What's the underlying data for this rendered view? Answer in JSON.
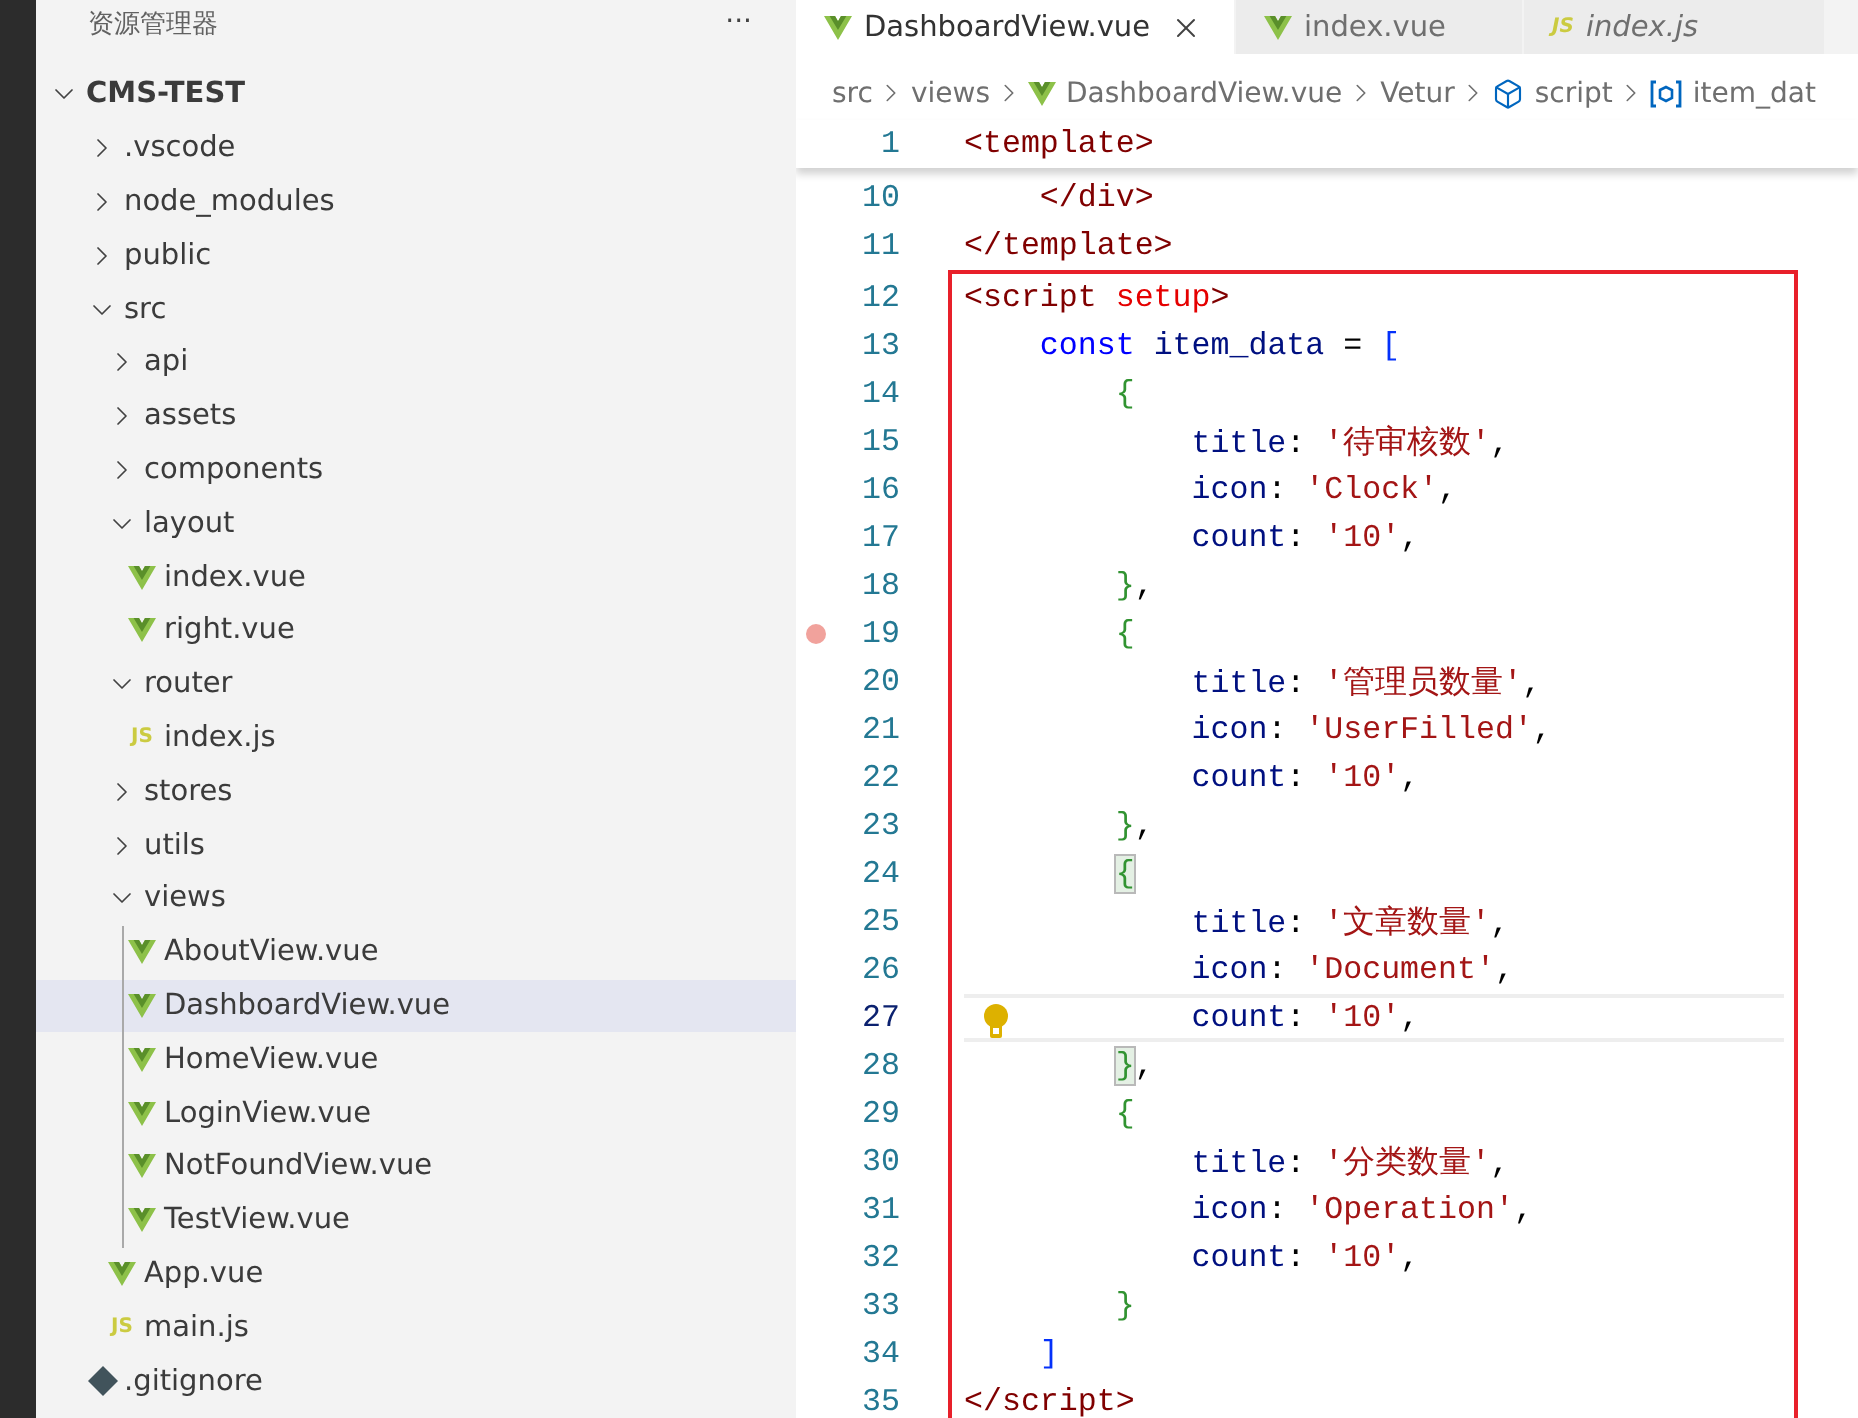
{
  "explorer": {
    "title": "资源管理器",
    "more": "···",
    "tree": [
      {
        "label": "CMS-TEST",
        "kind": "folder",
        "expanded": true,
        "selected": false,
        "children": [
          {
            "label": ".vscode",
            "kind": "folder",
            "expanded": false,
            "selected": false
          },
          {
            "label": "node_modules",
            "kind": "folder",
            "expanded": false,
            "selected": false
          },
          {
            "label": "public",
            "kind": "folder",
            "expanded": false,
            "selected": false
          },
          {
            "label": "src",
            "kind": "folder",
            "expanded": true,
            "selected": false,
            "children": [
              {
                "label": "api",
                "kind": "folder",
                "expanded": false,
                "selected": false
              },
              {
                "label": "assets",
                "kind": "folder",
                "expanded": false,
                "selected": false
              },
              {
                "label": "components",
                "kind": "folder",
                "expanded": false,
                "selected": false
              },
              {
                "label": "layout",
                "kind": "folder",
                "expanded": true,
                "selected": false,
                "children": [
                  {
                    "label": "index.vue",
                    "kind": "vue",
                    "selected": false
                  },
                  {
                    "label": "right.vue",
                    "kind": "vue",
                    "selected": false
                  }
                ]
              },
              {
                "label": "router",
                "kind": "folder",
                "expanded": true,
                "selected": false,
                "children": [
                  {
                    "label": "index.js",
                    "kind": "js",
                    "badge": "JS",
                    "selected": false
                  }
                ]
              },
              {
                "label": "stores",
                "kind": "folder",
                "expanded": false,
                "selected": false
              },
              {
                "label": "utils",
                "kind": "folder",
                "expanded": false,
                "selected": false
              },
              {
                "label": "views",
                "kind": "folder",
                "expanded": true,
                "selected": false,
                "children": [
                  {
                    "label": "AboutView.vue",
                    "kind": "vue",
                    "selected": false
                  },
                  {
                    "label": "DashboardView.vue",
                    "kind": "vue",
                    "selected": true
                  },
                  {
                    "label": "HomeView.vue",
                    "kind": "vue",
                    "selected": false
                  },
                  {
                    "label": "LoginView.vue",
                    "kind": "vue",
                    "selected": false
                  },
                  {
                    "label": "NotFoundView.vue",
                    "kind": "vue",
                    "selected": false
                  },
                  {
                    "label": "TestView.vue",
                    "kind": "vue",
                    "selected": false
                  }
                ]
              },
              {
                "label": "App.vue",
                "kind": "vue",
                "selected": false
              },
              {
                "label": "main.js",
                "kind": "js",
                "badge": "JS",
                "selected": false
              }
            ]
          },
          {
            "label": ".gitignore",
            "kind": "git",
            "selected": false
          }
        ]
      }
    ]
  },
  "tabs": [
    {
      "label": "DashboardView.vue",
      "kind": "vue",
      "selected": true,
      "preview": false
    },
    {
      "label": "index.vue",
      "kind": "vue",
      "selected": false,
      "preview": false
    },
    {
      "label": "index.js",
      "kind": "js",
      "badge": "JS",
      "selected": false,
      "preview": true
    }
  ],
  "breadcrumbs": [
    {
      "label": "src",
      "kind": "text"
    },
    {
      "label": "views",
      "kind": "text"
    },
    {
      "label": "DashboardView.vue",
      "kind": "vue"
    },
    {
      "label": "Vetur",
      "kind": "text"
    },
    {
      "label": "script",
      "kind": "module"
    },
    {
      "label": "item_dat",
      "kind": "variable"
    }
  ],
  "code": {
    "sticky_line": {
      "number": "1",
      "current": false,
      "tokens": [
        {
          "kind": "tag",
          "text": "<template>"
        }
      ]
    },
    "lines": [
      {
        "number": "10",
        "current": false,
        "tokens": [
          {
            "kind": "tag",
            "text": "    </div>"
          }
        ]
      },
      {
        "number": "11",
        "current": false,
        "tokens": [
          {
            "kind": "tag",
            "text": "</template>"
          }
        ]
      }
    ],
    "boxed_lines": [
      {
        "number": "12",
        "current": false,
        "tokens": [
          {
            "kind": "tag",
            "text": "<script "
          },
          {
            "kind": "attribute",
            "text": "setup"
          },
          {
            "kind": "tag",
            "text": ">"
          }
        ]
      },
      {
        "number": "13",
        "current": false,
        "tokens": [
          {
            "kind": "keyword",
            "text": "    const "
          },
          {
            "kind": "variable",
            "text": "item_data"
          },
          {
            "kind": "punct",
            "text": " = "
          },
          {
            "kind": "array",
            "text": "["
          }
        ]
      },
      {
        "number": "14",
        "current": false,
        "tokens": [
          {
            "kind": "brace",
            "text": "        {",
            "matched": false
          }
        ]
      },
      {
        "number": "15",
        "current": false,
        "tokens": [
          {
            "kind": "property",
            "text": "            title"
          },
          {
            "kind": "punct",
            "text": ": "
          },
          {
            "kind": "string",
            "text": "'待审核数'"
          },
          {
            "kind": "punct",
            "text": ","
          }
        ]
      },
      {
        "number": "16",
        "current": false,
        "tokens": [
          {
            "kind": "property",
            "text": "            icon"
          },
          {
            "kind": "punct",
            "text": ": "
          },
          {
            "kind": "string",
            "text": "'Clock'"
          },
          {
            "kind": "punct",
            "text": ","
          }
        ]
      },
      {
        "number": "17",
        "current": false,
        "tokens": [
          {
            "kind": "property",
            "text": "            count"
          },
          {
            "kind": "punct",
            "text": ": "
          },
          {
            "kind": "string",
            "text": "'10'"
          },
          {
            "kind": "punct",
            "text": ","
          }
        ]
      },
      {
        "number": "18",
        "current": false,
        "tokens": [
          {
            "kind": "brace",
            "text": "        }",
            "matched": false
          },
          {
            "kind": "punct",
            "text": ","
          }
        ]
      },
      {
        "number": "19",
        "current": false,
        "breakpoint_hint": true,
        "tokens": [
          {
            "kind": "brace",
            "text": "        {",
            "matched": false
          }
        ]
      },
      {
        "number": "20",
        "current": false,
        "tokens": [
          {
            "kind": "property",
            "text": "            title"
          },
          {
            "kind": "punct",
            "text": ": "
          },
          {
            "kind": "string",
            "text": "'管理员数量'"
          },
          {
            "kind": "punct",
            "text": ","
          }
        ]
      },
      {
        "number": "21",
        "current": false,
        "tokens": [
          {
            "kind": "property",
            "text": "            icon"
          },
          {
            "kind": "punct",
            "text": ": "
          },
          {
            "kind": "string",
            "text": "'UserFilled'"
          },
          {
            "kind": "punct",
            "text": ","
          }
        ]
      },
      {
        "number": "22",
        "current": false,
        "tokens": [
          {
            "kind": "property",
            "text": "            count"
          },
          {
            "kind": "punct",
            "text": ": "
          },
          {
            "kind": "string",
            "text": "'10'"
          },
          {
            "kind": "punct",
            "text": ","
          }
        ]
      },
      {
        "number": "23",
        "current": false,
        "tokens": [
          {
            "kind": "brace",
            "text": "        }",
            "matched": false
          },
          {
            "kind": "punct",
            "text": ","
          }
        ]
      },
      {
        "number": "24",
        "current": false,
        "tokens": [
          {
            "kind": "brace",
            "text": "        {",
            "matched": true
          }
        ]
      },
      {
        "number": "25",
        "current": false,
        "tokens": [
          {
            "kind": "property",
            "text": "            title"
          },
          {
            "kind": "punct",
            "text": ": "
          },
          {
            "kind": "string",
            "text": "'文章数量'"
          },
          {
            "kind": "punct",
            "text": ","
          }
        ]
      },
      {
        "number": "26",
        "current": false,
        "tokens": [
          {
            "kind": "property",
            "text": "            icon"
          },
          {
            "kind": "punct",
            "text": ": "
          },
          {
            "kind": "string",
            "text": "'Document'"
          },
          {
            "kind": "punct",
            "text": ","
          }
        ]
      },
      {
        "number": "27",
        "current": true,
        "lightbulb": true,
        "tokens": [
          {
            "kind": "property",
            "text": "            count"
          },
          {
            "kind": "punct",
            "text": ": "
          },
          {
            "kind": "string",
            "text": "'10'"
          },
          {
            "kind": "punct",
            "text": ","
          }
        ]
      },
      {
        "number": "28",
        "current": false,
        "tokens": [
          {
            "kind": "brace",
            "text": "        }",
            "matched": true
          },
          {
            "kind": "punct",
            "text": ","
          }
        ]
      },
      {
        "number": "29",
        "current": false,
        "tokens": [
          {
            "kind": "brace",
            "text": "        {",
            "matched": false
          }
        ]
      },
      {
        "number": "30",
        "current": false,
        "tokens": [
          {
            "kind": "property",
            "text": "            title"
          },
          {
            "kind": "punct",
            "text": ": "
          },
          {
            "kind": "string",
            "text": "'分类数量'"
          },
          {
            "kind": "punct",
            "text": ","
          }
        ]
      },
      {
        "number": "31",
        "current": false,
        "tokens": [
          {
            "kind": "property",
            "text": "            icon"
          },
          {
            "kind": "punct",
            "text": ": "
          },
          {
            "kind": "string",
            "text": "'Operation'"
          },
          {
            "kind": "punct",
            "text": ","
          }
        ]
      },
      {
        "number": "32",
        "current": false,
        "tokens": [
          {
            "kind": "property",
            "text": "            count"
          },
          {
            "kind": "punct",
            "text": ": "
          },
          {
            "kind": "string",
            "text": "'10'"
          },
          {
            "kind": "punct",
            "text": ","
          }
        ]
      },
      {
        "number": "33",
        "current": false,
        "tokens": [
          {
            "kind": "brace",
            "text": "        }",
            "matched": false
          }
        ]
      },
      {
        "number": "34",
        "current": false,
        "tokens": [
          {
            "kind": "array",
            "text": "    ]"
          }
        ]
      },
      {
        "number": "35",
        "current": false,
        "tokens": [
          {
            "kind": "tag",
            "text": "</script>"
          }
        ]
      }
    ]
  }
}
